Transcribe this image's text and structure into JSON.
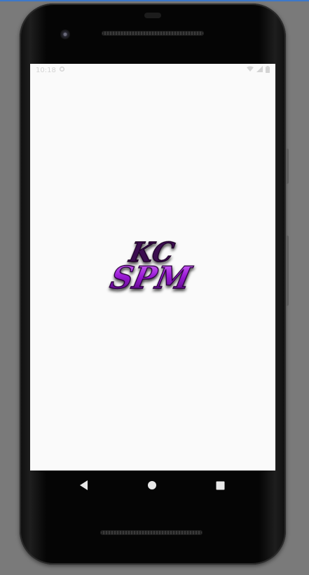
{
  "status_bar": {
    "time": "10:18",
    "left_icons": [
      "settings-gear-icon"
    ],
    "right_icons": [
      "wifi-icon",
      "signal-icon",
      "battery-icon"
    ]
  },
  "app": {
    "logo_line1": "KC",
    "logo_line2": "SPM",
    "logo_color": "#9b1bd6"
  },
  "navigation": {
    "back_icon": "back-triangle-icon",
    "home_icon": "home-circle-icon",
    "recents_icon": "recents-square-icon"
  },
  "colors": {
    "screen_background": "#fafafa",
    "device_body": "#050505",
    "desktop_background": "#7a7a7a"
  }
}
